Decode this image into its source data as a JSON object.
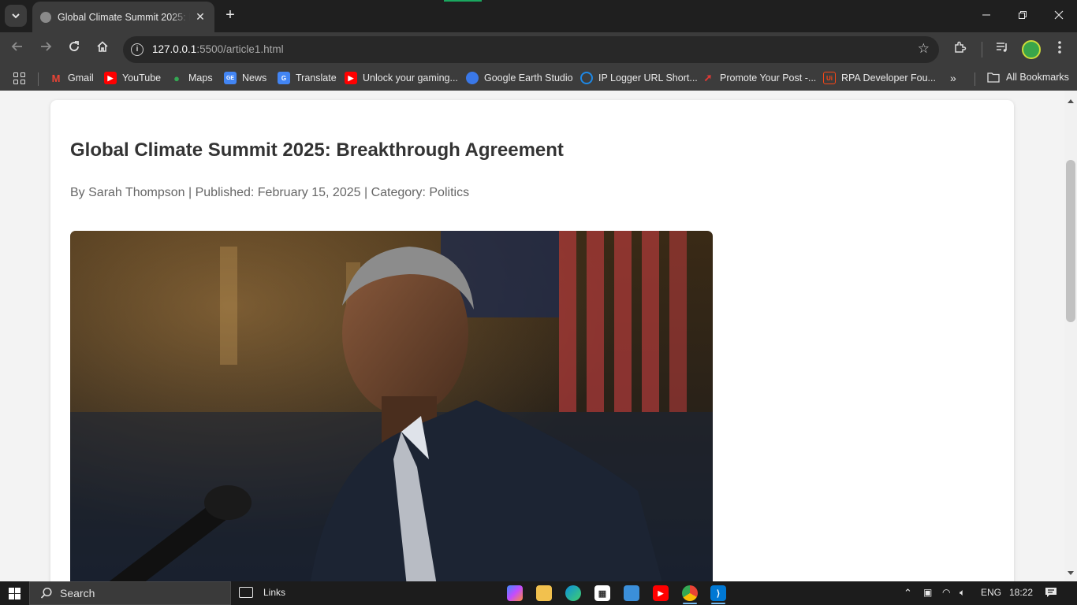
{
  "browser": {
    "tab_title": "Global Climate Summit 2025: Breakthrough Agreement",
    "url_host": "127.0.0.1",
    "url_rest": ":5500/article1.html",
    "bookmarks": [
      {
        "label": "Gmail",
        "icon": "gmail-icon",
        "color": "#ea4335"
      },
      {
        "label": "YouTube",
        "icon": "youtube-icon",
        "color": "#ff0000"
      },
      {
        "label": "Maps",
        "icon": "maps-icon",
        "color": "#34a853"
      },
      {
        "label": "News",
        "icon": "news-icon",
        "color": "#4285f4"
      },
      {
        "label": "Translate",
        "icon": "translate-icon",
        "color": "#4285f4"
      },
      {
        "label": "Unlock your gaming...",
        "icon": "youtube-icon",
        "color": "#ff0000"
      },
      {
        "label": "Google Earth Studio",
        "icon": "earth-icon",
        "color": "#3a78e8"
      },
      {
        "label": "IP Logger URL Short...",
        "icon": "iplogger-icon",
        "color": "#1e88e5"
      },
      {
        "label": "Promote Your Post -...",
        "icon": "rocket-icon",
        "color": "#e53935"
      },
      {
        "label": "RPA Developer Fou...",
        "icon": "uipath-icon",
        "color": "#fa4616"
      }
    ],
    "all_bookmarks_label": "All Bookmarks"
  },
  "article": {
    "headline": "Global Climate Summit 2025: Breakthrough Agreement",
    "meta": "By Sarah Thompson | Published: February 15, 2025 | Category: Politics"
  },
  "taskbar": {
    "search_label": "Search",
    "links_label": "Links",
    "language": "ENG",
    "time": "18:22"
  }
}
